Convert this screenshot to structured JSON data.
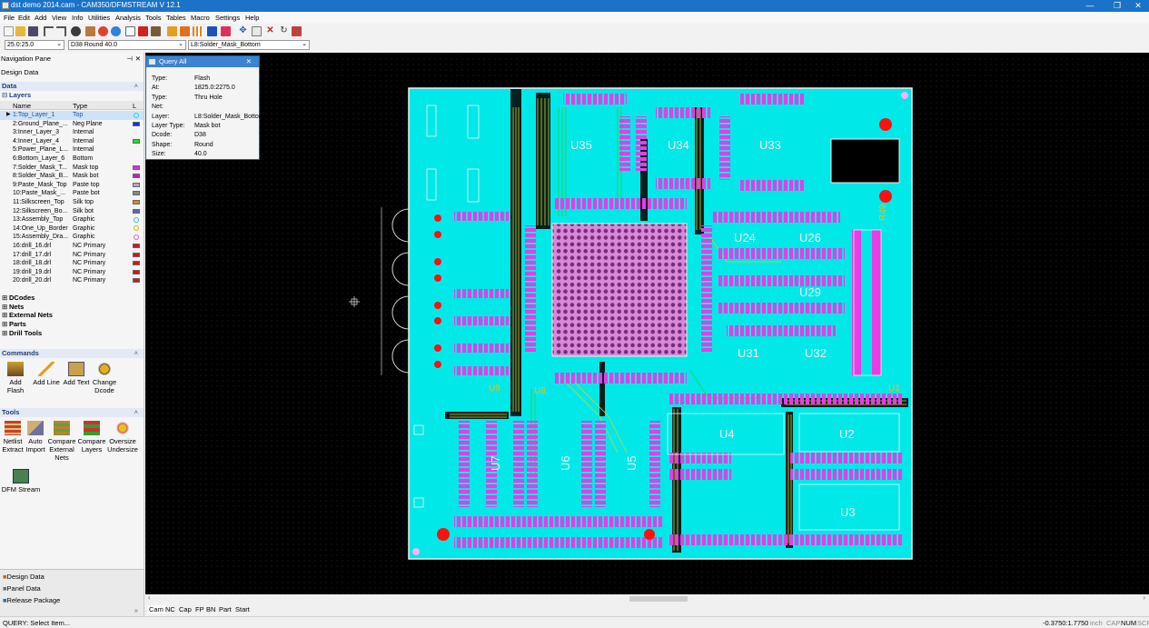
{
  "window": {
    "title": "dst demo 2014.cam - CAM350/DFMSTREAM V 12.1",
    "minimize": "—",
    "maximize": "❐",
    "close": "✕"
  },
  "menu": [
    "File",
    "Edit",
    "Add",
    "View",
    "Info",
    "Utilities",
    "Analysis",
    "Tools",
    "Tables",
    "Macro",
    "Settings",
    "Help"
  ],
  "combos": {
    "grid": "25.0:25.0",
    "dcode": "D38  Round 40.0",
    "layer": "L8:Solder_Mask_Bottom"
  },
  "nav": {
    "pane_title": "Navigation Pane",
    "tab": "Design Data",
    "data_section": "Data",
    "layers_label": "Layers",
    "col_name": "Name",
    "col_type": "Type",
    "col_l": "L",
    "layers": [
      {
        "name": "1:Top_Layer_1",
        "type": "Top",
        "color": "#00e5e5",
        "swatch": "ring"
      },
      {
        "name": "2:Ground_Plane_...",
        "type": "Neg Plane",
        "color": "#1a2ce0",
        "swatch": "fill"
      },
      {
        "name": "3:Inner_Layer_3",
        "type": "Internal",
        "color": "#f5f5f5",
        "swatch": "none"
      },
      {
        "name": "4:Inner_Layer_4",
        "type": "Internal",
        "color": "#22e022",
        "swatch": "fill"
      },
      {
        "name": "5:Power_Plane_L...",
        "type": "Internal",
        "color": "#f5f5f5",
        "swatch": "none"
      },
      {
        "name": "6:Bottom_Layer_6",
        "type": "Bottom",
        "color": "#f5f5f5",
        "swatch": "none"
      },
      {
        "name": "7:Solder_Mask_T...",
        "type": "Mask top",
        "color": "#e02ce0",
        "swatch": "fill"
      },
      {
        "name": "8:Solder_Mask_B...",
        "type": "Mask bot",
        "color": "#c020c0",
        "swatch": "fill"
      },
      {
        "name": "9:Paste_Mask_Top",
        "type": "Paste top",
        "color": "#b0b0b0",
        "swatch": "fill"
      },
      {
        "name": "10:Paste_Mask_...",
        "type": "Paste bot",
        "color": "#8a8a8a",
        "swatch": "fill"
      },
      {
        "name": "11:Silkscreen_Top",
        "type": "Silk top",
        "color": "#d88a20",
        "swatch": "fill"
      },
      {
        "name": "12:Silkscreen_Bo...",
        "type": "Silk bot",
        "color": "#6060c0",
        "swatch": "fill"
      },
      {
        "name": "13:Assembly_Top",
        "type": "Graphic",
        "color": "#30c0c0",
        "swatch": "ring"
      },
      {
        "name": "14:One_Up_Border",
        "type": "Graphic",
        "color": "#d0b020",
        "swatch": "ring"
      },
      {
        "name": "15:Assembly_Dra...",
        "type": "Graphic",
        "color": "#e060e0",
        "swatch": "ring"
      },
      {
        "name": "16:drill_16.drl",
        "type": "NC Primary",
        "color": "#e01010",
        "swatch": "fill"
      },
      {
        "name": "17:drill_17.drl",
        "type": "NC Primary",
        "color": "#e01010",
        "swatch": "fill"
      },
      {
        "name": "18:drill_18.drl",
        "type": "NC Primary",
        "color": "#e01010",
        "swatch": "fill"
      },
      {
        "name": "19:drill_19.drl",
        "type": "NC Primary",
        "color": "#e01010",
        "swatch": "fill"
      },
      {
        "name": "20:drill_20.drl",
        "type": "NC Primary",
        "color": "#e01010",
        "swatch": "fill"
      }
    ],
    "collapsed": [
      "DCodes",
      "Nets",
      "External Nets",
      "Parts",
      "Drill Tools"
    ],
    "commands_section": "Commands",
    "commands": [
      {
        "l1": "Add Flash",
        "l2": ""
      },
      {
        "l1": "Add Line",
        "l2": ""
      },
      {
        "l1": "Add Text",
        "l2": ""
      },
      {
        "l1": "Change",
        "l2": "Dcode"
      }
    ],
    "tools_section": "Tools",
    "tools": [
      {
        "l1": "Netlist",
        "l2": "Extract",
        "l3": ""
      },
      {
        "l1": "Auto",
        "l2": "Import",
        "l3": ""
      },
      {
        "l1": "Compare",
        "l2": "External",
        "l3": "Nets"
      },
      {
        "l1": "Compare",
        "l2": "Layers",
        "l3": ""
      },
      {
        "l1": "Oversize",
        "l2": "Undersize",
        "l3": ""
      }
    ],
    "dfm_tool": "DFM Stream",
    "bottom_tabs": [
      "Design Data",
      "Panel Data",
      "Release Package"
    ]
  },
  "query": {
    "title": "Query All",
    "close": "✕",
    "rows": [
      {
        "k": "Type:",
        "v": "Flash"
      },
      {
        "k": "At:",
        "v": "1825.0:2275.0"
      },
      {
        "k": "Type:",
        "v": "Thru Hole"
      },
      {
        "k": "Net:",
        "v": ""
      },
      {
        "k": "Layer:",
        "v": "L8:Solder_Mask_Bottom"
      },
      {
        "k": "Layer Type:",
        "v": "Mask bot"
      },
      {
        "k": "Dcode:",
        "v": "D38"
      },
      {
        "k": "Shape:",
        "v": "Round"
      },
      {
        "k": "Size:",
        "v": "40.0"
      }
    ]
  },
  "board": {
    "labels": [
      "U35",
      "U34",
      "U33",
      "U24",
      "U26",
      "U29",
      "U31",
      "U32",
      "U4",
      "U2",
      "U3",
      "U6",
      "U5",
      "U7",
      "U8",
      "U1",
      "U9",
      "R49"
    ],
    "copper_color": "#00e8e8",
    "mask_color": "#e53ee5",
    "trace_color": "#e0d020",
    "drill_color": "#ff1010"
  },
  "view_tabs": [
    "Cam",
    "NC",
    "Cap",
    "FP",
    "BN",
    "Part",
    "Start"
  ],
  "status": {
    "left": "QUERY: Select Item...",
    "coords": "-0.3750:1.7750",
    "unit": "inch",
    "caps": "CAP",
    "num": "NUM",
    "scr": "SCR"
  }
}
